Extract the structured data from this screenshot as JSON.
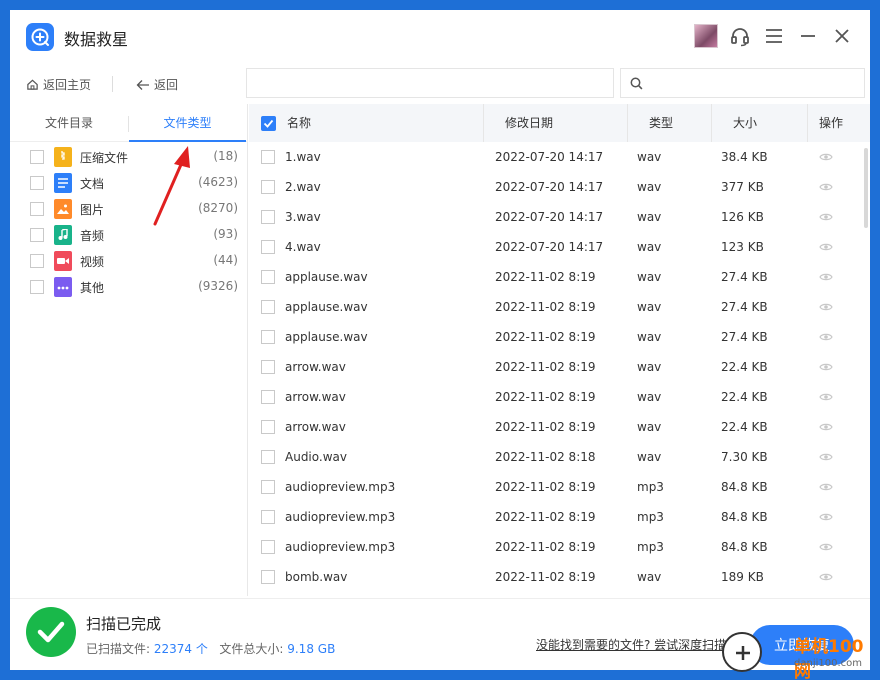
{
  "app": {
    "title": "数据救星"
  },
  "toolbar": {
    "home_label": "返回主页",
    "back_label": "返回",
    "path_value": "",
    "search_value": ""
  },
  "sidebar": {
    "tabs": [
      {
        "label": "文件目录"
      },
      {
        "label": "文件类型"
      }
    ],
    "categories": [
      {
        "label": "压缩文件",
        "count": "(18)",
        "icon": "archive-icon",
        "color": "#f5b21b"
      },
      {
        "label": "文档",
        "count": "(4623)",
        "icon": "document-icon",
        "color": "#2d7ff9"
      },
      {
        "label": "图片",
        "count": "(8270)",
        "icon": "image-icon",
        "color": "#ff8a2a"
      },
      {
        "label": "音频",
        "count": "(93)",
        "icon": "music-icon",
        "color": "#19b38a"
      },
      {
        "label": "视频",
        "count": "(44)",
        "icon": "video-icon",
        "color": "#f04b5b"
      },
      {
        "label": "其他",
        "count": "(9326)",
        "icon": "more-icon",
        "color": "#7b5cf0"
      }
    ]
  },
  "table": {
    "headers": {
      "name": "名称",
      "date": "修改日期",
      "type": "类型",
      "size": "大小",
      "action": "操作"
    },
    "rows": [
      {
        "name": "1.wav",
        "date": "2022-07-20 14:17",
        "type": "wav",
        "size": "38.4 KB"
      },
      {
        "name": "2.wav",
        "date": "2022-07-20 14:17",
        "type": "wav",
        "size": "377 KB"
      },
      {
        "name": "3.wav",
        "date": "2022-07-20 14:17",
        "type": "wav",
        "size": "126 KB"
      },
      {
        "name": "4.wav",
        "date": "2022-07-20 14:17",
        "type": "wav",
        "size": "123 KB"
      },
      {
        "name": "applause.wav",
        "date": "2022-11-02 8:19",
        "type": "wav",
        "size": "27.4 KB"
      },
      {
        "name": "applause.wav",
        "date": "2022-11-02 8:19",
        "type": "wav",
        "size": "27.4 KB"
      },
      {
        "name": "applause.wav",
        "date": "2022-11-02 8:19",
        "type": "wav",
        "size": "27.4 KB"
      },
      {
        "name": "arrow.wav",
        "date": "2022-11-02 8:19",
        "type": "wav",
        "size": "22.4 KB"
      },
      {
        "name": "arrow.wav",
        "date": "2022-11-02 8:19",
        "type": "wav",
        "size": "22.4 KB"
      },
      {
        "name": "arrow.wav",
        "date": "2022-11-02 8:19",
        "type": "wav",
        "size": "22.4 KB"
      },
      {
        "name": "Audio.wav",
        "date": "2022-11-02 8:18",
        "type": "wav",
        "size": "7.30 KB"
      },
      {
        "name": "audiopreview.mp3",
        "date": "2022-11-02 8:19",
        "type": "mp3",
        "size": "84.8 KB"
      },
      {
        "name": "audiopreview.mp3",
        "date": "2022-11-02 8:19",
        "type": "mp3",
        "size": "84.8 KB"
      },
      {
        "name": "audiopreview.mp3",
        "date": "2022-11-02 8:19",
        "type": "mp3",
        "size": "84.8 KB"
      },
      {
        "name": "bomb.wav",
        "date": "2022-11-02 8:19",
        "type": "wav",
        "size": "189 KB"
      }
    ]
  },
  "footer": {
    "status_title": "扫描已完成",
    "scanned_label": "已扫描文件:",
    "scanned_count": "22374 个",
    "total_label": "文件总大小:",
    "total_size": "9.18 GB",
    "deep_scan_link": "没能找到需要的文件? 尝试深度扫描",
    "recover_button": "立即恢复"
  },
  "watermark": {
    "brand": "单机100网",
    "url": "danji100.com"
  },
  "colors": {
    "accent": "#2d7ff9",
    "success": "#19b84a",
    "desktop": "#1e6fd6"
  }
}
